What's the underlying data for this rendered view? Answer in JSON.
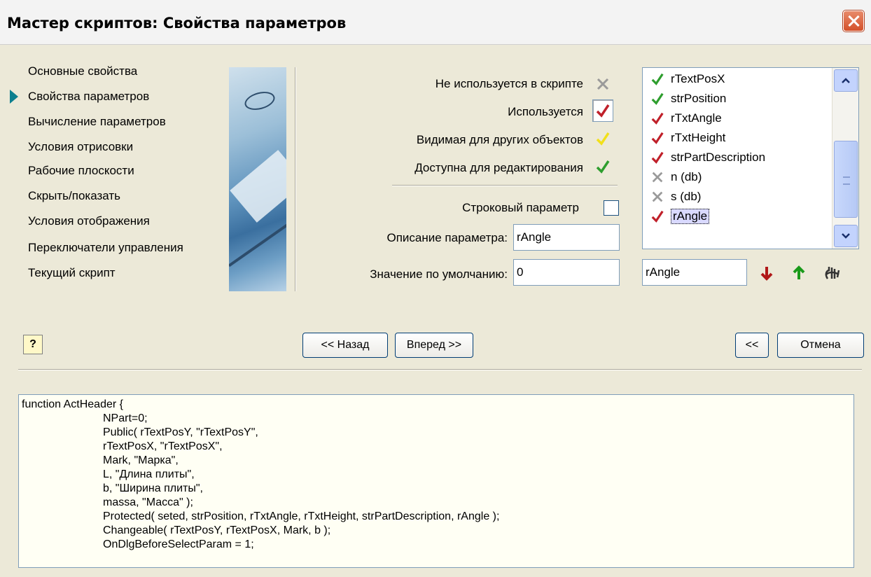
{
  "window": {
    "title": "Мастер скриптов:  Свойства параметров"
  },
  "nav": {
    "items": [
      {
        "label": "Основные свойства"
      },
      {
        "label": "Свойства параметров",
        "active": true
      },
      {
        "label": "Вычисление параметров"
      },
      {
        "label": "Условия отрисовки"
      },
      {
        "label": "Рабочие плоскости"
      },
      {
        "label": "Скрыть/показать"
      },
      {
        "label": "Условия отображения"
      },
      {
        "label": "Переключатели управления"
      },
      {
        "label": "Текущий скрипт"
      }
    ]
  },
  "legend": {
    "not_used": "Не используется в скрипте",
    "used": "Используется",
    "visible": "Видимая для других объектов",
    "editable": "Доступна для редактирования"
  },
  "form": {
    "string_param_label": "Строковый параметр",
    "string_param_checked": false,
    "description_label": "Описание параметра:",
    "description_value": "rAngle",
    "default_label": "Значение по умолчанию:",
    "default_value": "0"
  },
  "params": {
    "items": [
      {
        "name": "rTextPosX",
        "icon": "check-green"
      },
      {
        "name": "strPosition",
        "icon": "check-green"
      },
      {
        "name": "rTxtAngle",
        "icon": "check-red"
      },
      {
        "name": "rTxtHeight",
        "icon": "check-red"
      },
      {
        "name": "strPartDescription",
        "icon": "check-red"
      },
      {
        "name": "n (db)",
        "icon": "cross-gray"
      },
      {
        "name": "s (db)",
        "icon": "cross-gray"
      },
      {
        "name": "rAngle",
        "icon": "check-red",
        "selected": true
      }
    ],
    "rename_value": "rAngle"
  },
  "buttons": {
    "back": "<< Назад",
    "next": "Вперед >>",
    "collapse": "<<",
    "cancel": "Отмена",
    "help": "?"
  },
  "colors": {
    "check_green": "#2e9e2e",
    "check_red": "#c0202a",
    "check_yellow": "#f2e01a",
    "cross_gray": "#9a9a9a",
    "arrow_down": "#b01818",
    "arrow_up": "#1a9a1a"
  },
  "code": {
    "lines": [
      {
        "text": "function ActHeader {",
        "indent": 0
      },
      {
        "text": "NPart=0;",
        "indent": 1
      },
      {
        "text": "Public( rTextPosY, \"rTextPosY\",",
        "indent": 1
      },
      {
        "text": "rTextPosX, \"rTextPosX\",",
        "indent": 1
      },
      {
        "text": "Mark, \"Марка\",",
        "indent": 1
      },
      {
        "text": "L, \"Длина плиты\",",
        "indent": 1
      },
      {
        "text": "b, \"Ширина плиты\",",
        "indent": 1
      },
      {
        "text": "massa, \"Масса\" );",
        "indent": 1
      },
      {
        "text": "Protected( seted, strPosition, rTxtAngle, rTxtHeight, strPartDescription, rAngle );",
        "indent": 1
      },
      {
        "text": "Changeable( rTextPosY, rTextPosX, Mark, b );",
        "indent": 1
      },
      {
        "text": "OnDlgBeforeSelectParam = 1;",
        "indent": 1
      }
    ]
  }
}
